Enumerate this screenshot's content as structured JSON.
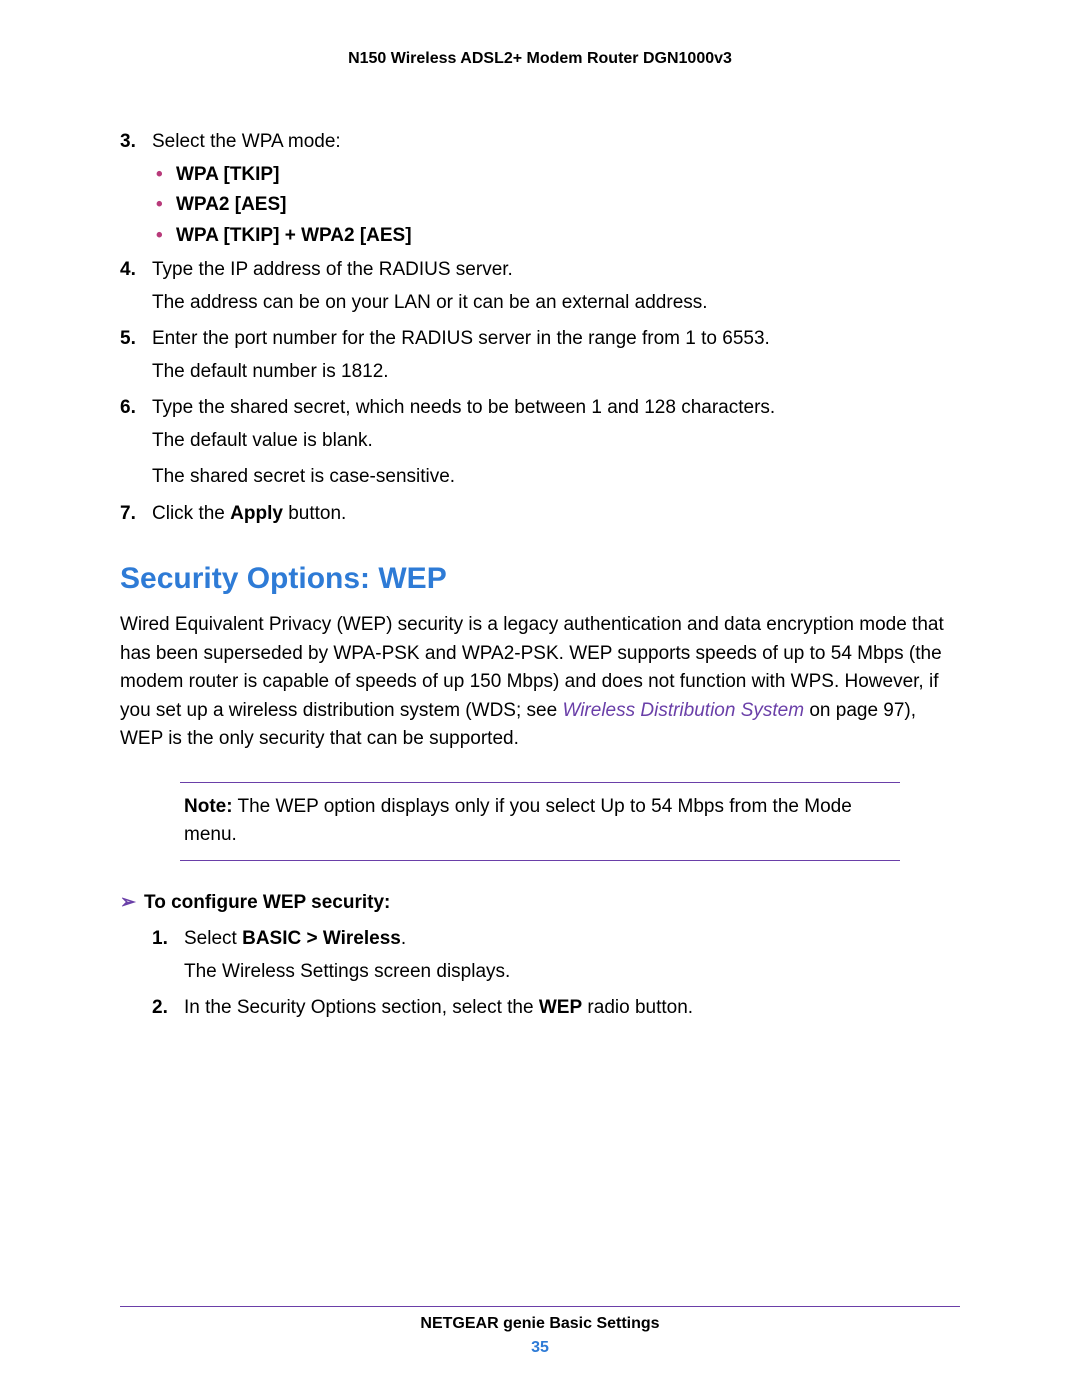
{
  "header": {
    "product": "N150 Wireless ADSL2+ Modem Router DGN1000v3"
  },
  "steps_top": {
    "s3": {
      "num": "3.",
      "text": "Select the WPA mode:",
      "opts": [
        "WPA [TKIP]",
        "WPA2 [AES]",
        "WPA [TKIP] + WPA2 [AES]"
      ]
    },
    "s4": {
      "num": "4.",
      "text": "Type the IP address of the RADIUS server.",
      "para": "The address can be on your LAN or it can be an external address."
    },
    "s5": {
      "num": "5.",
      "text": "Enter the port number for the RADIUS server in the range from 1 to 6553.",
      "para": "The default number is 1812."
    },
    "s6": {
      "num": "6.",
      "text": "Type the shared secret, which needs to be between 1 and 128 characters.",
      "para1": "The default value is blank.",
      "para2": "The shared secret is case-sensitive."
    },
    "s7": {
      "num": "7.",
      "pre": "Click the ",
      "bold": "Apply",
      "post": " button."
    }
  },
  "section": {
    "heading": "Security Options: WEP",
    "body_pre": "Wired Equivalent Privacy (WEP) security is a legacy authentication and data encryption mode that has been superseded by WPA-PSK and WPA2-PSK. WEP supports speeds of up to 54 Mbps (the modem router is capable of speeds of up 150 Mbps) and does not function with WPS. However, if you set up a wireless distribution system (WDS; see ",
    "body_link": "Wireless Distribution System",
    "body_post": " on page 97), WEP is the only security that can be supported."
  },
  "note": {
    "label": "Note:",
    "text": " The WEP option displays only if you select Up to 54 Mbps from the Mode menu."
  },
  "procedure": {
    "arrow": "➢",
    "title": "To configure WEP security:",
    "i1": {
      "num": "1.",
      "pre": "Select ",
      "bold": "BASIC > Wireless",
      "post": ".",
      "para": "The Wireless Settings screen displays."
    },
    "i2": {
      "num": "2.",
      "pre": "In the Security Options section, select the ",
      "bold": "WEP",
      "post": " radio button."
    }
  },
  "footer": {
    "title": "NETGEAR genie Basic Settings",
    "page": "35"
  }
}
